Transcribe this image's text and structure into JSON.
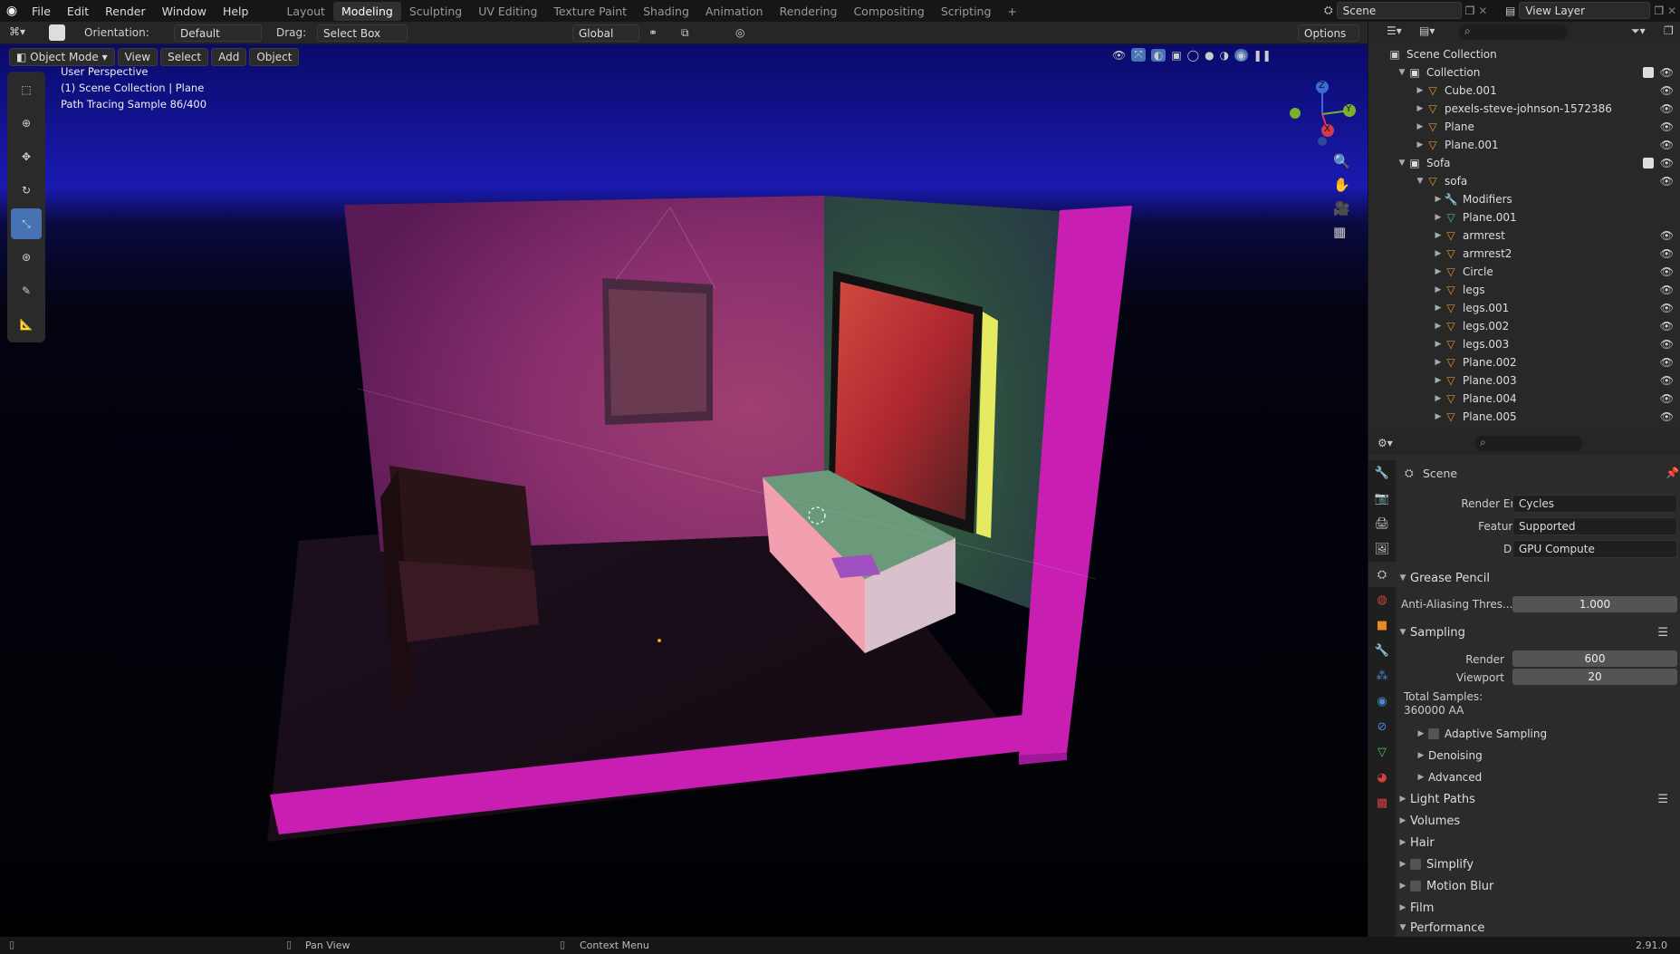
{
  "topbar": {
    "menus": [
      "File",
      "Edit",
      "Render",
      "Window",
      "Help"
    ],
    "workspaces": [
      "Layout",
      "Modeling",
      "Sculpting",
      "UV Editing",
      "Texture Paint",
      "Shading",
      "Animation",
      "Rendering",
      "Compositing",
      "Scripting"
    ],
    "active_workspace": "Modeling",
    "add_tab": "+",
    "scene": "Scene",
    "view_layer": "View Layer"
  },
  "header": {
    "orientation_label": "Orientation:",
    "orientation_value": "Default",
    "drag_label": "Drag:",
    "drag_value": "Select Box",
    "transform_value": "Global",
    "options": "Options"
  },
  "viewport_header": {
    "mode": "Object Mode",
    "menus": [
      "View",
      "Select",
      "Add",
      "Object"
    ]
  },
  "overlay": {
    "line1": "User Perspective",
    "line2": "(1) Scene Collection | Plane",
    "line3": "Path Tracing Sample 86/400"
  },
  "gizmo": {
    "x": "X",
    "y": "Y",
    "z": "Z"
  },
  "outliner": {
    "root": "Scene Collection",
    "rows": [
      {
        "indent": 1,
        "name": "Collection",
        "type": "collection",
        "check": true
      },
      {
        "indent": 2,
        "name": "Cube.001",
        "type": "object"
      },
      {
        "indent": 2,
        "name": "pexels-steve-johnson-1572386",
        "type": "object"
      },
      {
        "indent": 2,
        "name": "Plane",
        "type": "object"
      },
      {
        "indent": 2,
        "name": "Plane.001",
        "type": "object"
      },
      {
        "indent": 1,
        "name": "Sofa",
        "type": "collection",
        "check": true
      },
      {
        "indent": 2,
        "name": "sofa",
        "type": "object"
      },
      {
        "indent": 3,
        "name": "Modifiers",
        "type": "modifier"
      },
      {
        "indent": 3,
        "name": "Plane.001",
        "type": "mesh"
      },
      {
        "indent": 3,
        "name": "armrest",
        "type": "object"
      },
      {
        "indent": 3,
        "name": "armrest2",
        "type": "object"
      },
      {
        "indent": 3,
        "name": "Circle",
        "type": "object"
      },
      {
        "indent": 3,
        "name": "legs",
        "type": "object"
      },
      {
        "indent": 3,
        "name": "legs.001",
        "type": "object"
      },
      {
        "indent": 3,
        "name": "legs.002",
        "type": "object"
      },
      {
        "indent": 3,
        "name": "legs.003",
        "type": "object"
      },
      {
        "indent": 3,
        "name": "Plane.002",
        "type": "object"
      },
      {
        "indent": 3,
        "name": "Plane.003",
        "type": "object"
      },
      {
        "indent": 3,
        "name": "Plane.004",
        "type": "object"
      },
      {
        "indent": 3,
        "name": "Plane.005",
        "type": "object"
      }
    ]
  },
  "properties": {
    "context": "Scene",
    "render_engine_label": "Render Engine",
    "render_engine": "Cycles",
    "feature_set_label": "Feature Set",
    "feature_set": "Supported",
    "device_label": "Device",
    "device": "GPU Compute",
    "grease_pencil": "Grease Pencil",
    "aa_label": "Anti-Aliasing Thres...",
    "aa_value": "1.000",
    "sampling": "Sampling",
    "render_label": "Render",
    "render_value": "600",
    "viewport_label": "Viewport",
    "viewport_value": "20",
    "total_samples_label": "Total Samples:",
    "total_samples_value": "360000 AA",
    "adaptive": "Adaptive Sampling",
    "denoising": "Denoising",
    "advanced": "Advanced",
    "sections": [
      "Light Paths",
      "Volumes",
      "Hair",
      "Simplify",
      "Motion Blur",
      "Film",
      "Performance"
    ]
  },
  "status": {
    "pan": "Pan View",
    "context": "Context Menu",
    "version": "2.91.0"
  }
}
